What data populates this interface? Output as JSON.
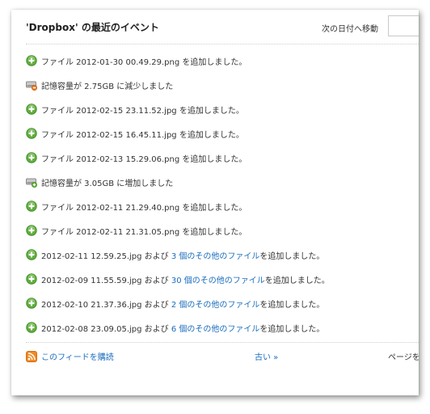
{
  "header": {
    "title": "'Dropbox' の最近のイベント",
    "date_jump_label": "次の日付へ移動",
    "date_input_value": ""
  },
  "events": [
    {
      "icon": "add-icon",
      "parts": [
        {
          "text": "ファイル 2012-01-30 00.49.29.png を追加しました。",
          "link": false
        }
      ]
    },
    {
      "icon": "storage-decrease-icon",
      "parts": [
        {
          "text": "記憶容量が 2.75GB に減少しました",
          "link": false
        }
      ]
    },
    {
      "icon": "add-icon",
      "parts": [
        {
          "text": "ファイル 2012-02-15 23.11.52.jpg を追加しました。",
          "link": false
        }
      ]
    },
    {
      "icon": "add-icon",
      "parts": [
        {
          "text": "ファイル 2012-02-15 16.45.11.jpg を追加しました。",
          "link": false
        }
      ]
    },
    {
      "icon": "add-icon",
      "parts": [
        {
          "text": "ファイル 2012-02-13 15.29.06.png を追加しました。",
          "link": false
        }
      ]
    },
    {
      "icon": "storage-increase-icon",
      "parts": [
        {
          "text": "記憶容量が 3.05GB に増加しました",
          "link": false
        }
      ]
    },
    {
      "icon": "add-icon",
      "parts": [
        {
          "text": "ファイル 2012-02-11 21.29.40.png を追加しました。",
          "link": false
        }
      ]
    },
    {
      "icon": "add-icon",
      "parts": [
        {
          "text": "ファイル 2012-02-11 21.31.05.png を追加しました。",
          "link": false
        }
      ]
    },
    {
      "icon": "add-icon",
      "parts": [
        {
          "text": "2012-02-11 12.59.25.jpg および ",
          "link": false
        },
        {
          "text": "3 個のその他のファイル",
          "link": true
        },
        {
          "text": "を追加しました。",
          "link": false
        }
      ]
    },
    {
      "icon": "add-icon",
      "parts": [
        {
          "text": "2012-02-09 11.55.59.jpg および ",
          "link": false
        },
        {
          "text": "30 個のその他のファイル",
          "link": true
        },
        {
          "text": "を追加しました。",
          "link": false
        }
      ]
    },
    {
      "icon": "add-icon",
      "parts": [
        {
          "text": "2012-02-10 21.37.36.jpg および ",
          "link": false
        },
        {
          "text": "2 個のその他のファイル",
          "link": true
        },
        {
          "text": "を追加しました。",
          "link": false
        }
      ]
    },
    {
      "icon": "add-icon",
      "parts": [
        {
          "text": "2012-02-08 23.09.05.jpg および ",
          "link": false
        },
        {
          "text": "6 個のその他のファイル",
          "link": true
        },
        {
          "text": "を追加しました。",
          "link": false
        }
      ]
    }
  ],
  "footer": {
    "feed_icon": "rss-icon",
    "feed_label": "このフィードを購読",
    "older_label": "古い »",
    "page_label": "ページを"
  },
  "colors": {
    "link": "#1a6dbd",
    "add_green": "#5fae3c",
    "rss_orange": "#f08a24"
  }
}
